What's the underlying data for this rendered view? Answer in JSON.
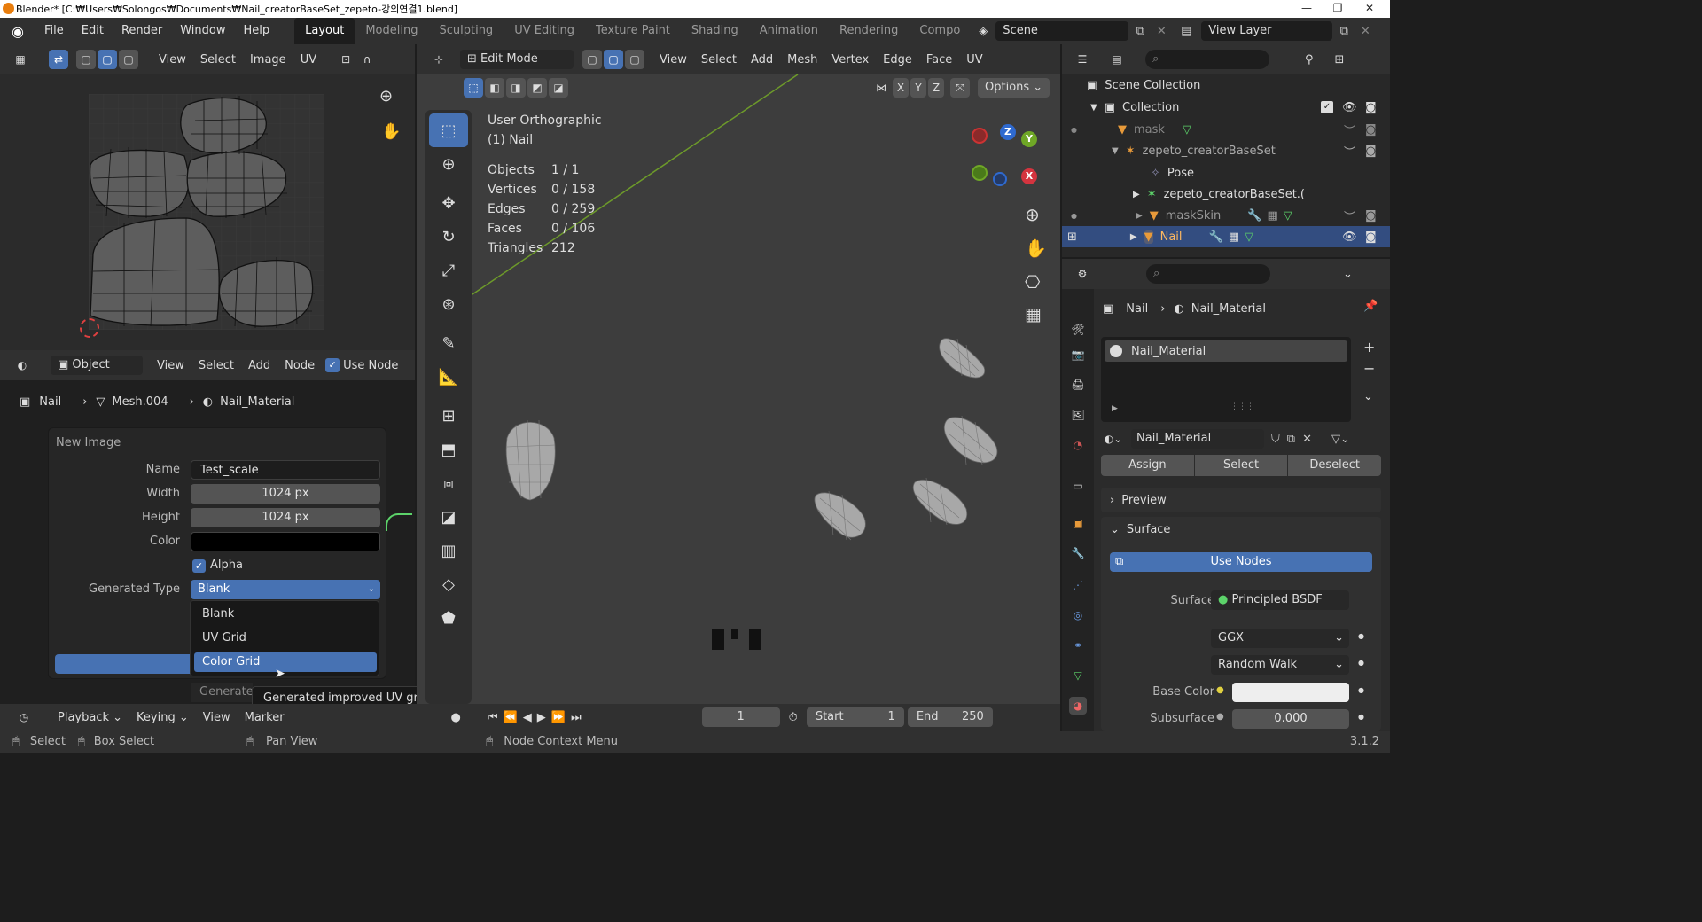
{
  "window": {
    "title": "Blender* [C:₩Users₩Solongos₩Documents₩Nail_creatorBaseSet_zepeto-강의연결1.blend]",
    "minimize": "—",
    "maximize": "❐",
    "close": "✕"
  },
  "menubar": {
    "items": [
      "File",
      "Edit",
      "Render",
      "Window",
      "Help"
    ],
    "workspaces": [
      "Layout",
      "Modeling",
      "Sculpting",
      "UV Editing",
      "Texture Paint",
      "Shading",
      "Animation",
      "Rendering",
      "Compo"
    ],
    "scene": "Scene",
    "view_layer": "View Layer"
  },
  "uv_editor": {
    "menus": [
      "View",
      "Select",
      "Image",
      "UV"
    ]
  },
  "viewport": {
    "mode": "Edit Mode",
    "menus": [
      "View",
      "Select",
      "Add",
      "Mesh",
      "Vertex",
      "Edge",
      "Face",
      "UV"
    ],
    "options": "Options",
    "overlay_title": "User Orthographic",
    "overlay_object": "(1) Nail",
    "stats": [
      {
        "k": "Objects",
        "v": "1 / 1"
      },
      {
        "k": "Vertices",
        "v": "0 / 158"
      },
      {
        "k": "Edges",
        "v": "0 / 259"
      },
      {
        "k": "Faces",
        "v": "0 / 106"
      },
      {
        "k": "Triangles",
        "v": "212"
      }
    ],
    "axes": {
      "x": "X",
      "y": "Y",
      "z": "Z"
    }
  },
  "node_editor": {
    "mode": "Object",
    "menus": [
      "View",
      "Select",
      "Add",
      "Node"
    ],
    "use_nodes": "Use Node",
    "breadcrumb": [
      "Nail",
      "Mesh.004",
      "Nail_Material"
    ]
  },
  "new_image": {
    "title": "New Image",
    "name_label": "Name",
    "name_value": "Test_scale",
    "width_label": "Width",
    "width_value": "1024 px",
    "height_label": "Height",
    "height_value": "1024 px",
    "color_label": "Color",
    "alpha_label": "Alpha",
    "gentype_label": "Generated Type",
    "gentype_value": "Blank",
    "options": [
      "Blank",
      "UV Grid",
      "Color Grid"
    ],
    "selected_option": "Color Grid",
    "partial_label": "Generate",
    "tooltip": "Generated improved UV grid to test UV mappings."
  },
  "timeline": {
    "menus": [
      "Playback",
      "Keying",
      "View",
      "Marker"
    ],
    "current_frame": "1",
    "start_label": "Start",
    "start_value": "1",
    "end_label": "End",
    "end_value": "250"
  },
  "outliner": {
    "scene_collection": "Scene Collection",
    "items": [
      {
        "name": "Collection"
      },
      {
        "name": "mask"
      },
      {
        "name": "zepeto_creatorBaseSet"
      },
      {
        "name": "Pose"
      },
      {
        "name": "zepeto_creatorBaseSet.("
      },
      {
        "name": "maskSkin"
      },
      {
        "name": "Nail"
      }
    ]
  },
  "properties": {
    "breadcrumb": [
      "Nail",
      "Nail_Material"
    ],
    "slot": "Nail_Material",
    "material_name": "Nail_Material",
    "assign": "Assign",
    "select": "Select",
    "deselect": "Deselect",
    "preview": "Preview",
    "surface": "Surface",
    "use_nodes": "Use Nodes",
    "surface_label": "Surface",
    "surface_value": "Principled BSDF",
    "distribution": "GGX",
    "subsurface_method": "Random Walk",
    "base_color_label": "Base Color",
    "subsurface_label": "Subsurface",
    "subsurface_value": "0.000"
  },
  "statusbar": {
    "select": "Select",
    "box_select": "Box Select",
    "pan_view": "Pan View",
    "context": "Node Context Menu",
    "version": "3.1.2"
  },
  "colors": {
    "accent": "#4772b3",
    "bg": "#1d1d1d",
    "header": "#303030"
  }
}
